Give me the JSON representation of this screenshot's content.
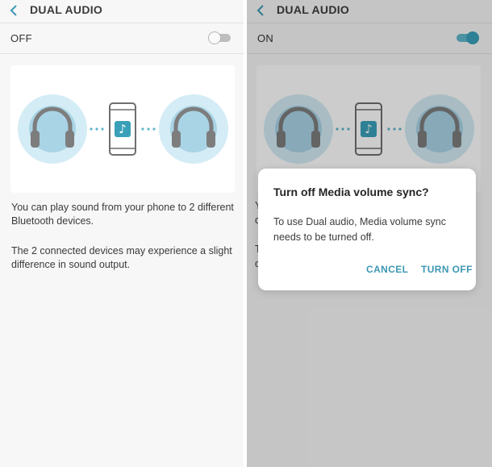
{
  "left_screen": {
    "header": {
      "title": "DUAL AUDIO",
      "back_icon": "chevron-left-icon"
    },
    "toggle_row": {
      "label": "OFF",
      "switch_on": false
    },
    "illustration": {
      "icons": [
        "headphones-icon",
        "phone-icon",
        "music-note-icon",
        "headphones-icon"
      ],
      "note_glyph": "♪"
    },
    "description": {
      "paragraph_1": "You can play sound from your phone to 2 different Bluetooth devices.",
      "paragraph_2": "The 2 connected devices may experience a slight difference in sound output."
    }
  },
  "right_screen": {
    "header": {
      "title": "DUAL AUDIO",
      "back_icon": "chevron-left-icon"
    },
    "toggle_row": {
      "label": "ON",
      "switch_on": true
    },
    "illustration": {
      "note_glyph": "♪"
    },
    "obscured_text": {
      "line_1": "Y",
      "line_2": "c",
      "line_3": "T",
      "line_4": "c"
    },
    "dialog": {
      "title": "Turn off Media volume sync?",
      "body": "To use Dual audio, Media volume sync needs to be turned off.",
      "cancel_label": "CANCEL",
      "confirm_label": "TURN OFF"
    }
  },
  "colors": {
    "accent": "#3d98b4",
    "switch_on_track": "#5fb7cc",
    "switch_off_track": "#bdbdbd",
    "halo": "#d4ecf5",
    "headphone_gray": "#7f7f7f",
    "scrim": "rgba(0,0,0,0.2)"
  }
}
